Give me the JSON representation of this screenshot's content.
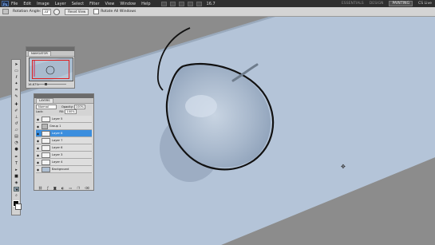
{
  "menubar": {
    "logo": "Ps",
    "items": [
      "File",
      "Edit",
      "Image",
      "Layer",
      "Select",
      "Filter",
      "View",
      "Window",
      "Help"
    ],
    "zoom": "16.7",
    "workspaces": [
      "ESSENTIALS",
      "DESIGN",
      "PAINTING"
    ],
    "active_workspace": "PAINTING",
    "cslive": "CS Live"
  },
  "options": {
    "rotation_label": "Rotation Angle:",
    "rotation_value": "33°",
    "reset_button": "Reset View",
    "rotate_all_label": "Rotate All Windows"
  },
  "navigator": {
    "tab": "NAVIGATOR",
    "zoom": "16.67%"
  },
  "layers": {
    "tab": "LAYERS",
    "blend_mode": "Normal",
    "opacity_label": "Opacity:",
    "opacity_value": "100%",
    "lock_label": "Lock:",
    "fill_label": "Fill:",
    "fill_value": "100%",
    "items": [
      {
        "name": "Layer 5"
      },
      {
        "name": "Group 1"
      },
      {
        "name": "Layer 8"
      },
      {
        "name": "Layer 7"
      },
      {
        "name": "Layer 6"
      },
      {
        "name": "Layer 3"
      },
      {
        "name": "Layer 4"
      },
      {
        "name": "Background"
      }
    ],
    "active_index": 2
  },
  "colors": {
    "canvas": "#b4c4d8",
    "workspace": "#8c8c8c",
    "active_layer": "#3b8ede",
    "nav_frame": "#e02020"
  },
  "icons": [
    "ps-logo",
    "eye-icon",
    "folder-icon",
    "link-icon",
    "fx-icon",
    "mask-icon",
    "adjustment-icon",
    "new-group-icon",
    "new-layer-icon",
    "trash-icon"
  ]
}
